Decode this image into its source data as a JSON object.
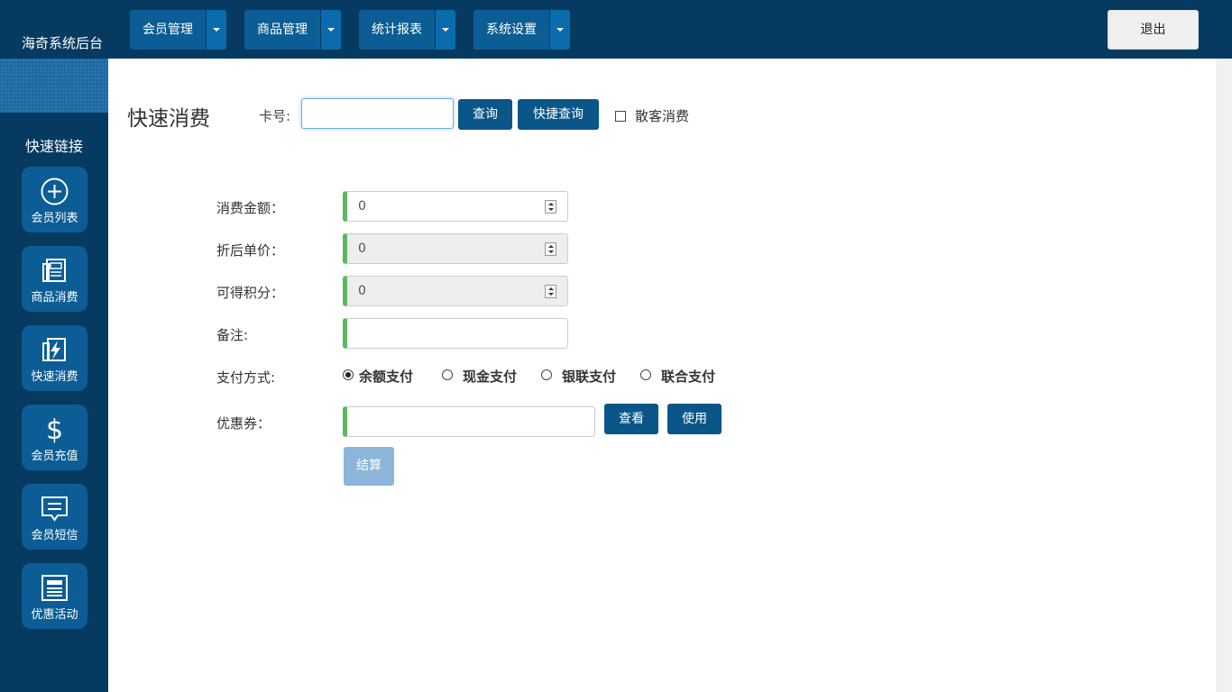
{
  "app": {
    "brand": "海奇系统后台"
  },
  "topnav": {
    "items": [
      {
        "label": "会员管理"
      },
      {
        "label": "商品管理"
      },
      {
        "label": "统计报表"
      },
      {
        "label": "系统设置"
      }
    ],
    "logout_label": "退出"
  },
  "sidebar": {
    "quick_title": "快速链接",
    "links": [
      {
        "label": "会员列表",
        "icon": "plus-circle-icon"
      },
      {
        "label": "商品消费",
        "icon": "document-icon"
      },
      {
        "label": "快速消费",
        "icon": "lightning-icon"
      },
      {
        "label": "会员充值",
        "icon": "dollar-icon"
      },
      {
        "label": "会员短信",
        "icon": "message-icon"
      },
      {
        "label": "优惠活动",
        "icon": "newspaper-icon"
      }
    ]
  },
  "main": {
    "title": "快速消费",
    "card_label": "卡号:",
    "card_value": "",
    "query_button": "查询",
    "quick_query_button": "快捷查询",
    "walkin_label": "散客消费",
    "walkin_checked": false,
    "form": {
      "amount_label": "消费金额：",
      "amount_value": "0",
      "unit_price_label": "折后单价：",
      "unit_price_value": "0",
      "points_label": "可得积分：",
      "points_value": "0",
      "note_label": "备注:",
      "note_value": "",
      "payment_label": "支付方式:",
      "payment_options": [
        {
          "label": "余额支付",
          "checked": true
        },
        {
          "label": "现金支付",
          "checked": false
        },
        {
          "label": "银联支付",
          "checked": false
        },
        {
          "label": "联合支付",
          "checked": false
        }
      ],
      "coupon_label": "优惠券：",
      "coupon_value": "",
      "view_button": "查看",
      "use_button": "使用",
      "settle_button": "结算"
    }
  },
  "colors": {
    "topbar": "#063a60",
    "nav_button": "#0c5d95",
    "primary_button": "#0a5688",
    "input_accent": "#5cb85c",
    "disabled_button": "#8cb5d9"
  }
}
